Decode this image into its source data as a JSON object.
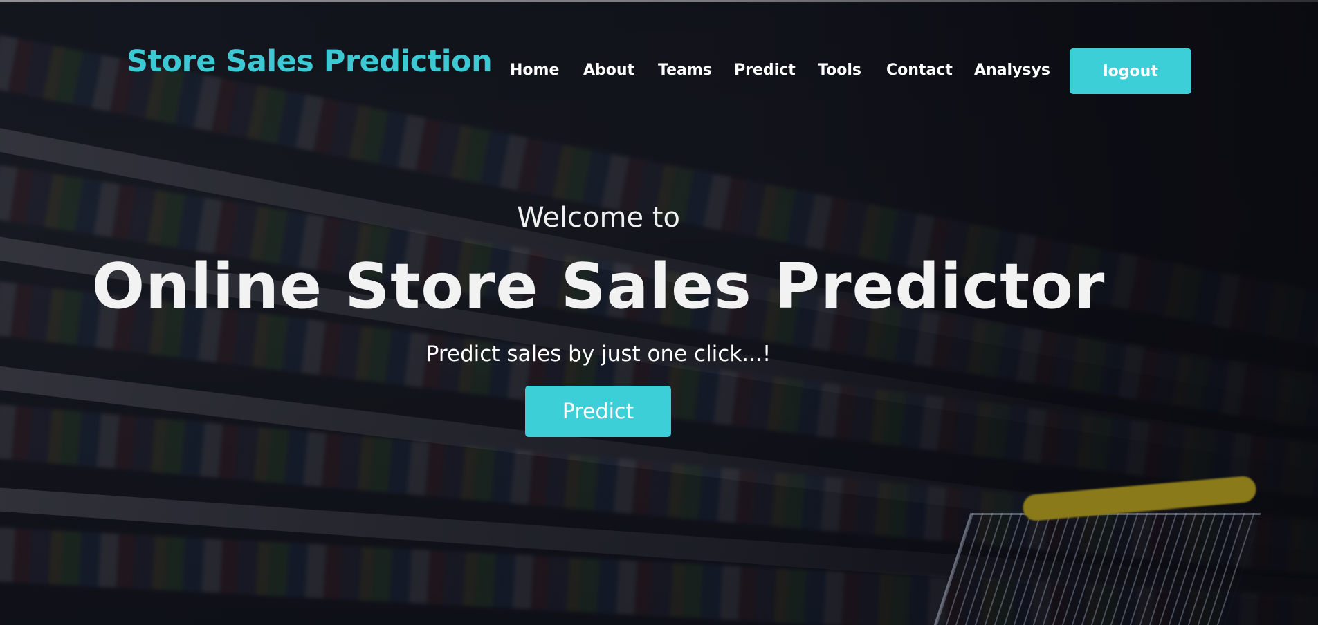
{
  "navbar": {
    "brand": "Store Sales Prediction",
    "links": [
      {
        "label": "Home"
      },
      {
        "label": "About"
      },
      {
        "label": "Teams"
      },
      {
        "label": "Predict"
      },
      {
        "label": "Tools"
      },
      {
        "label": "Contact"
      },
      {
        "label": "Analysys"
      }
    ],
    "logout_label": "logout"
  },
  "hero": {
    "welcome": "Welcome to",
    "headline": "Online Store Sales Predictor",
    "tagline": "Predict sales by just one click...!",
    "cta_label": "Predict"
  },
  "colors": {
    "accent": "#3ccfd7",
    "brand_text": "#3cc9d4",
    "overlay": "#0f1118"
  }
}
